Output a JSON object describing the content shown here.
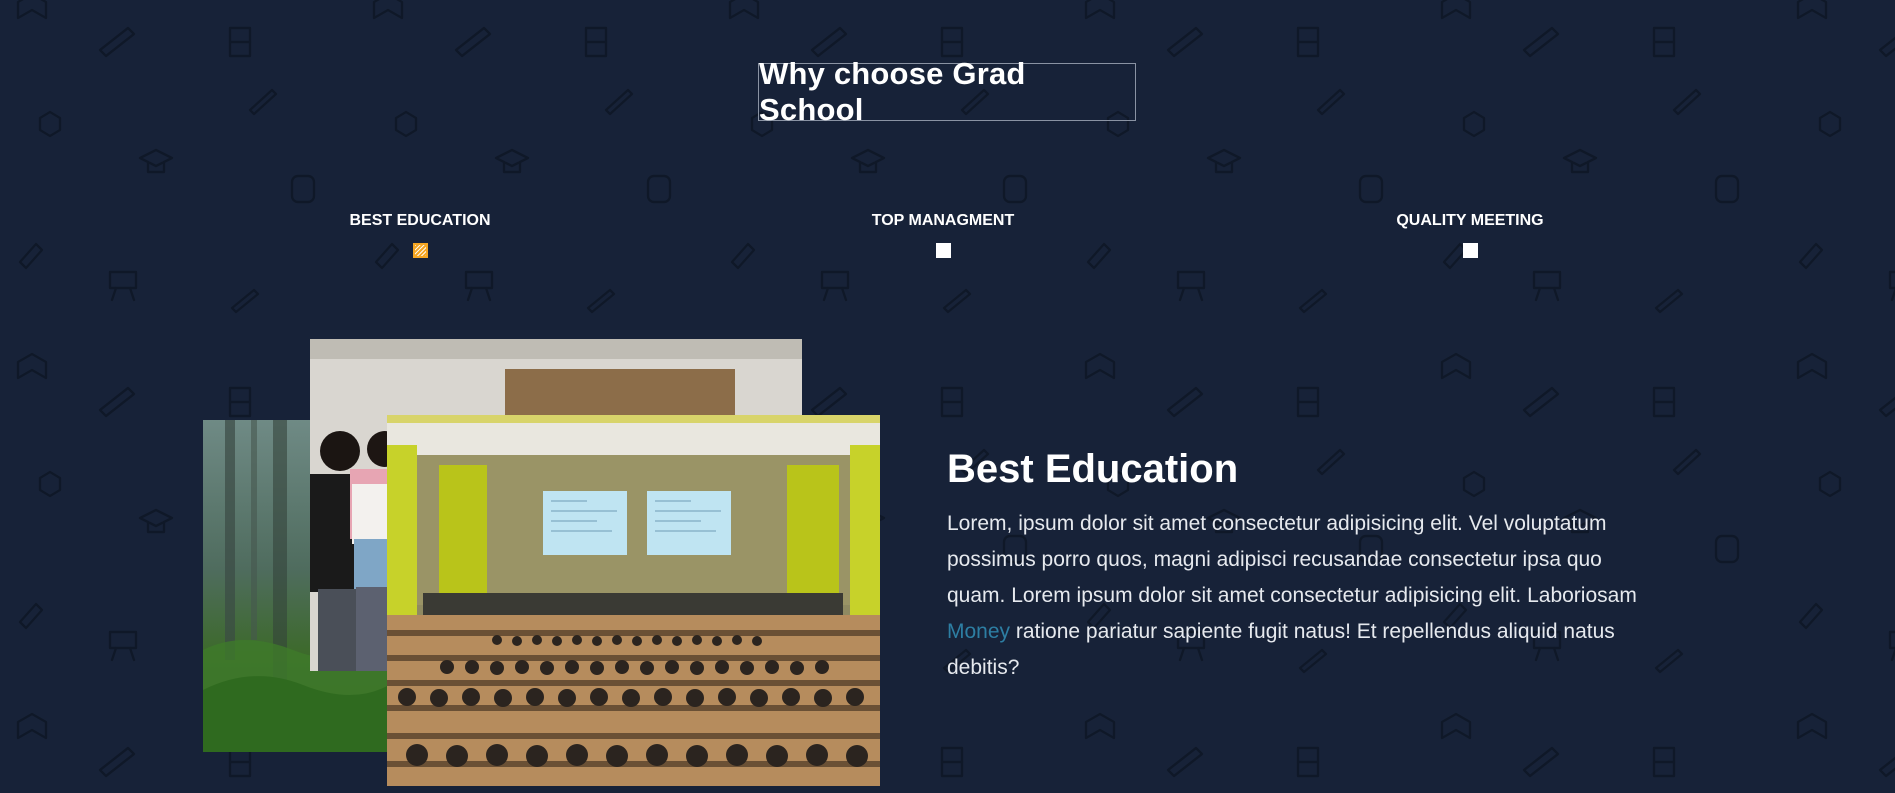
{
  "section": {
    "title": "Why choose Grad School"
  },
  "tabs": [
    {
      "label": "BEST EDUCATION",
      "active": true
    },
    {
      "label": "TOP MANAGMENT",
      "active": false
    },
    {
      "label": "QUALITY MEETING",
      "active": false
    }
  ],
  "content": {
    "title": "Best Education",
    "text_before": "Lorem, ipsum dolor sit amet consectetur adipisicing elit. Vel voluptatum possimus porro quos, magni adipisci recusandae consectetur ipsa quo quam. Lorem ipsum dolor sit amet consectetur adipisicing elit. Laboriosam ",
    "link_text": "Money",
    "text_after": " ratione pariatur sapiente fugit natus! Et repellendus aliquid natus debitis?"
  },
  "colors": {
    "background": "#172238",
    "active_marker": "#f5a623",
    "link": "#2d7ea3"
  }
}
